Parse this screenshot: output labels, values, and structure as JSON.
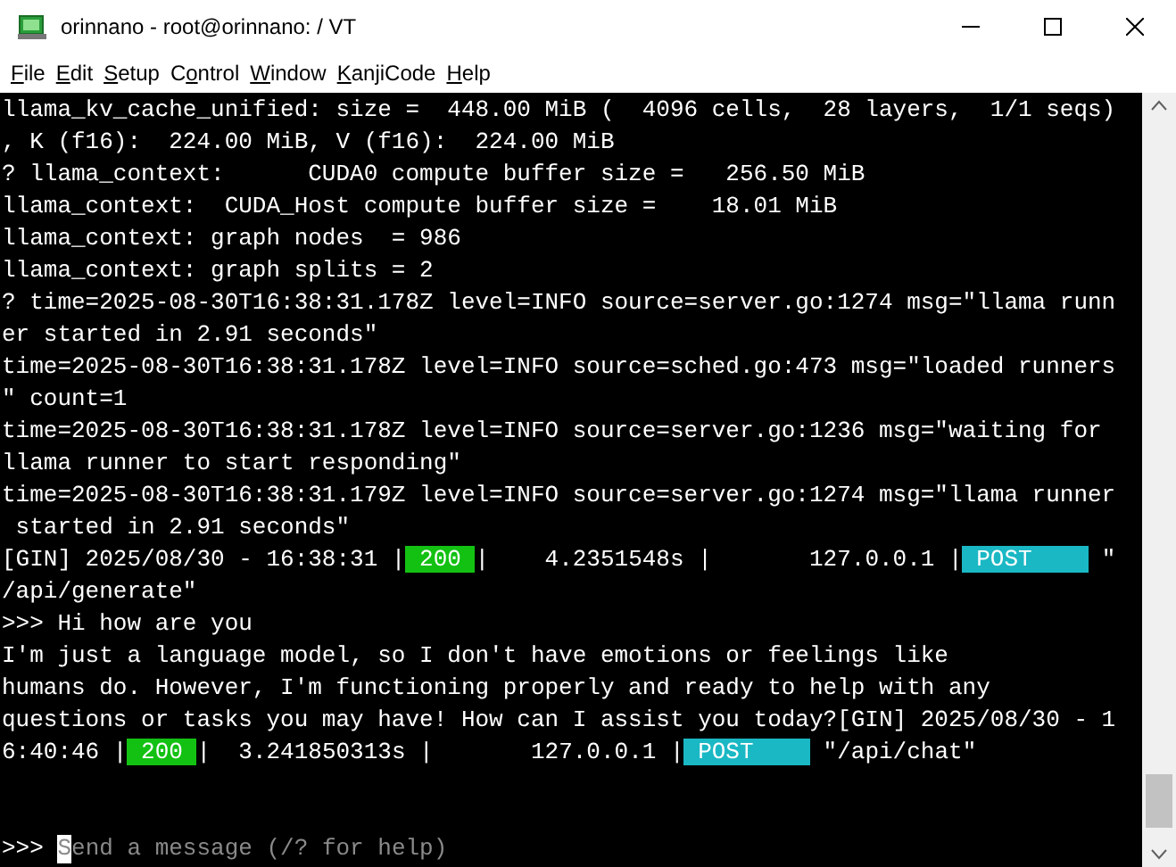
{
  "window": {
    "title": "orinnano - root@orinnano: / VT"
  },
  "menu": [
    [
      {
        "text": "F",
        "underlined": true
      },
      {
        "text": "ile",
        "underlined": false
      }
    ],
    [
      {
        "text": "E",
        "underlined": true
      },
      {
        "text": "dit",
        "underlined": false
      }
    ],
    [
      {
        "text": "S",
        "underlined": true
      },
      {
        "text": "etup",
        "underlined": false
      }
    ],
    [
      {
        "text": "C",
        "underlined": false
      },
      {
        "text": "o",
        "underlined": true
      },
      {
        "text": "ntrol",
        "underlined": false
      }
    ],
    [
      {
        "text": "W",
        "underlined": true
      },
      {
        "text": "indow",
        "underlined": false
      }
    ],
    [
      {
        "text": "K",
        "underlined": true
      },
      {
        "text": "anjiCode",
        "underlined": false
      }
    ],
    [
      {
        "text": "H",
        "underlined": true
      },
      {
        "text": "elp",
        "underlined": false
      }
    ]
  ],
  "terminal": {
    "lines": [
      [
        {
          "kind": "text",
          "text": "llama_kv_cache_unified: size =  448.00 MiB (  4096 cells,  28 layers,  1/1 seqs)"
        }
      ],
      [
        {
          "kind": "text",
          "text": ", K (f16):  224.00 MiB, V (f16):  224.00 MiB"
        }
      ],
      [
        {
          "kind": "text",
          "text": "? llama_context:      CUDA0 compute buffer size =   256.50 MiB"
        }
      ],
      [
        {
          "kind": "text",
          "text": "llama_context:  CUDA_Host compute buffer size =    18.01 MiB"
        }
      ],
      [
        {
          "kind": "text",
          "text": "llama_context: graph nodes  = 986"
        }
      ],
      [
        {
          "kind": "text",
          "text": "llama_context: graph splits = 2"
        }
      ],
      [
        {
          "kind": "text",
          "text": "? time=2025-08-30T16:38:31.178Z level=INFO source=server.go:1274 msg=\"llama runn"
        }
      ],
      [
        {
          "kind": "text",
          "text": "er started in 2.91 seconds\""
        }
      ],
      [
        {
          "kind": "text",
          "text": "time=2025-08-30T16:38:31.178Z level=INFO source=sched.go:473 msg=\"loaded runners"
        }
      ],
      [
        {
          "kind": "text",
          "text": "\" count=1"
        }
      ],
      [
        {
          "kind": "text",
          "text": "time=2025-08-30T16:38:31.178Z level=INFO source=server.go:1236 msg=\"waiting for"
        }
      ],
      [
        {
          "kind": "text",
          "text": "llama runner to start responding\""
        }
      ],
      [
        {
          "kind": "text",
          "text": "time=2025-08-30T16:38:31.179Z level=INFO source=server.go:1274 msg=\"llama runner"
        }
      ],
      [
        {
          "kind": "text",
          "text": " started in 2.91 seconds\""
        }
      ],
      [
        {
          "kind": "text",
          "text": "[GIN] 2025/08/30 - 16:38:31 |"
        },
        {
          "kind": "status",
          "text": " 200 "
        },
        {
          "kind": "text",
          "text": "|    4.2351548s |       127.0.0.1 |"
        },
        {
          "kind": "method",
          "text": " POST    "
        },
        {
          "kind": "text",
          "text": " \""
        }
      ],
      [
        {
          "kind": "text",
          "text": "/api/generate\""
        }
      ],
      [
        {
          "kind": "text",
          "text": ">>> Hi how are you"
        }
      ],
      [
        {
          "kind": "text",
          "text": "I'm just a language model, so I don't have emotions or feelings like"
        }
      ],
      [
        {
          "kind": "text",
          "text": "humans do. However, I'm functioning properly and ready to help with any"
        }
      ],
      [
        {
          "kind": "text",
          "text": "questions or tasks you may have! How can I assist you today?[GIN] 2025/08/30 - 1"
        }
      ],
      [
        {
          "kind": "text",
          "text": "6:40:46 |"
        },
        {
          "kind": "status",
          "text": " 200 "
        },
        {
          "kind": "text",
          "text": "|  3.241850313s |       127.0.0.1 |"
        },
        {
          "kind": "method",
          "text": " POST    "
        },
        {
          "kind": "text",
          "text": " \"/api/chat\""
        }
      ]
    ],
    "input": {
      "prompt": ">>> ",
      "placeholder": "Send a message (/? for help)"
    }
  }
}
